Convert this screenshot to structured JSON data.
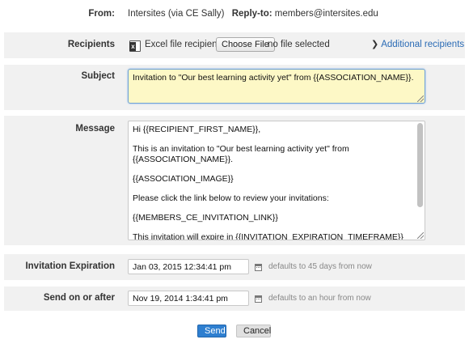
{
  "from": {
    "label": "From:",
    "value": "Intersites (via CE Sally)",
    "reply_to_label": "Reply-to:",
    "reply_to_value": "members@intersites.edu"
  },
  "recipients": {
    "label": "Recipients",
    "excel_icon": "excel-file-icon",
    "excel_label": "Excel file recipients",
    "choose_file_label": "Choose File",
    "no_file_text": "no file selected",
    "additional_label": "Additional recipients"
  },
  "subject": {
    "label": "Subject",
    "value": "Invitation to \"Our best learning activity yet\" from {{ASSOCIATION_NAME}}."
  },
  "message": {
    "label": "Message",
    "paragraphs": [
      "Hi {{RECIPIENT_FIRST_NAME}},",
      "This is an invitation to \"Our best learning activity yet\" from {{ASSOCIATION_NAME}}.",
      "{{ASSOCIATION_IMAGE}}",
      "Please click the link below to review your invitations:",
      "{{MEMBERS_CE_INVITATION_LINK}}",
      "This invitation will expire in {{INVITATION_EXPIRATION_TIMEFRAME}} on {{INVITATION_EXPIRATION_DATE}}."
    ]
  },
  "expiration": {
    "label": "Invitation Expiration",
    "value": "Jan 03, 2015 12:34:41 pm",
    "hint": "defaults to 45 days from now"
  },
  "send_on": {
    "label": "Send on or after",
    "value": "Nov 19, 2014 1:34:41 pm",
    "hint": "defaults to an hour from now"
  },
  "actions": {
    "send_label": "Send",
    "cancel_label": "Cancel"
  },
  "colors": {
    "row_background": "#f1f1f1",
    "subject_highlight": "#fdf8c6",
    "link": "#2a6bb5",
    "primary_button": "#2e7fd0"
  }
}
